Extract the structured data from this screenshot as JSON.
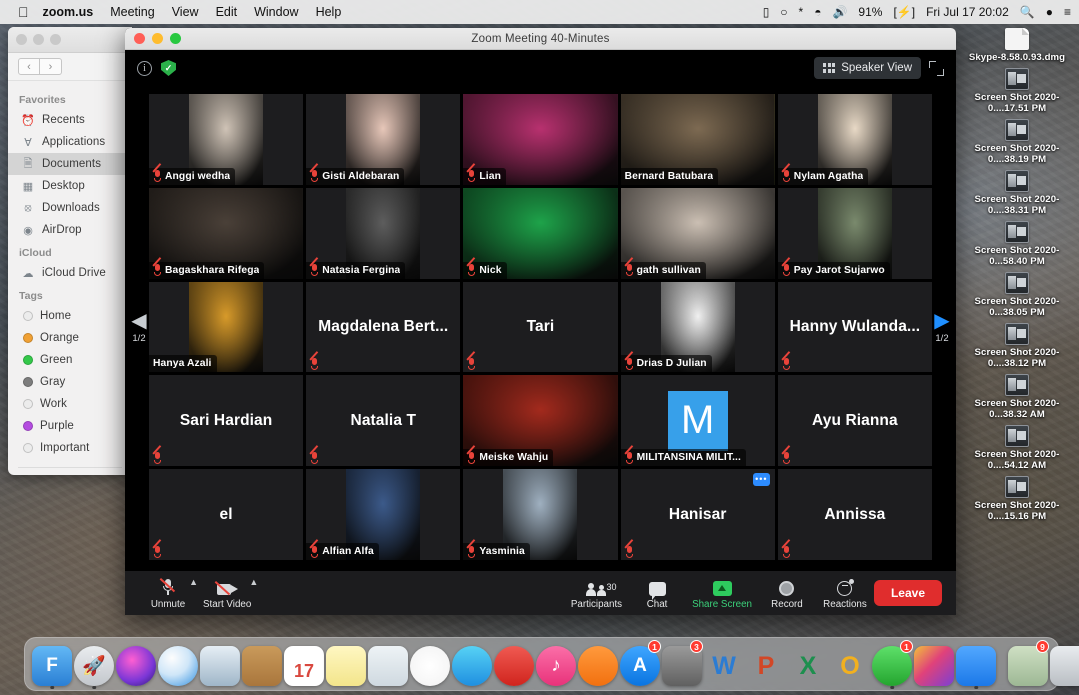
{
  "menubar": {
    "apple": "",
    "items": [
      {
        "label": "zoom.us",
        "bold": true
      },
      {
        "label": "Meeting"
      },
      {
        "label": "View"
      },
      {
        "label": "Edit"
      },
      {
        "label": "Window"
      },
      {
        "label": "Help"
      }
    ],
    "status": {
      "battery_percent": "91%",
      "charging": "[⚡]",
      "datetime": "Fri Jul 17  20:02",
      "search_icon": "search-icon",
      "siri_icon": "siri-icon",
      "controlcenter_icon": "notification-center-icon",
      "display_icon": "display-icon",
      "timemachine_icon": "time-machine-icon",
      "bluetooth_icon": "bluetooth-icon",
      "wifi_icon": "wifi-icon",
      "volume_icon": "volume-icon"
    }
  },
  "finder": {
    "back_label": "‹",
    "forward_label": "›",
    "sections": [
      {
        "title": "Favorites",
        "items": [
          {
            "label": "Recents",
            "icon": "clock-icon",
            "glyph": "◷",
            "selected": false
          },
          {
            "label": "Applications",
            "icon": "applications-icon",
            "glyph": "A",
            "selected": false
          },
          {
            "label": "Documents",
            "icon": "documents-folder-icon",
            "glyph": "🗎",
            "selected": true
          },
          {
            "label": "Desktop",
            "icon": "desktop-icon",
            "glyph": "▤",
            "selected": false
          },
          {
            "label": "Downloads",
            "icon": "downloads-icon",
            "glyph": "⬇",
            "selected": false
          },
          {
            "label": "AirDrop",
            "icon": "airdrop-icon",
            "glyph": "◉",
            "selected": false
          }
        ]
      },
      {
        "title": "iCloud",
        "items": [
          {
            "label": "iCloud Drive",
            "icon": "cloud-icon",
            "glyph": "☁",
            "selected": false
          }
        ]
      },
      {
        "title": "Tags",
        "tags": [
          {
            "label": "Home",
            "color": "#e8e8e8"
          },
          {
            "label": "Orange",
            "color": "#f0a033"
          },
          {
            "label": "Green",
            "color": "#34c84a"
          },
          {
            "label": "Gray",
            "color": "#7d7d7d"
          },
          {
            "label": "Work",
            "color": "#e8e8e8"
          },
          {
            "label": "Purple",
            "color": "#b44ce0"
          },
          {
            "label": "Important",
            "color": "#e8e8e8"
          }
        ]
      }
    ]
  },
  "desktop_files": [
    {
      "name": "Skype-8.58.0.93.dmg",
      "icon": "dmg-file-icon",
      "type": "doc"
    },
    {
      "name": "Screen Shot 2020-0....17.51 PM",
      "icon": "screenshot-file-icon",
      "type": "shot"
    },
    {
      "name": "Screen Shot 2020-0....38.19 PM",
      "icon": "screenshot-file-icon",
      "type": "shot"
    },
    {
      "name": "Screen Shot 2020-0....38.31 PM",
      "icon": "screenshot-file-icon",
      "type": "shot"
    },
    {
      "name": "Screen Shot 2020-0...58.40 PM",
      "icon": "screenshot-file-icon",
      "type": "shot"
    },
    {
      "name": "Screen Shot 2020-0...38.05 PM",
      "icon": "screenshot-file-icon",
      "type": "shot"
    },
    {
      "name": "Screen Shot 2020-0....38.12 PM",
      "icon": "screenshot-file-icon",
      "type": "shot"
    },
    {
      "name": "Screen Shot 2020-0...38.32 AM",
      "icon": "screenshot-file-icon",
      "type": "shot"
    },
    {
      "name": "Screen Shot 2020-0....54.12 AM",
      "icon": "screenshot-file-icon",
      "type": "shot"
    },
    {
      "name": "Screen Shot 2020-0....15.16 PM",
      "icon": "screenshot-file-icon",
      "type": "shot"
    }
  ],
  "zoom_window": {
    "title": "Zoom Meeting   40-Minutes",
    "info_icon": "info-icon",
    "encryption_icon": "shield-encryption-icon",
    "view_button": "Speaker View",
    "view_icon": "grid-view-icon",
    "fullscreen_icon": "fullscreen-icon",
    "pager": {
      "left_icon": "previous-page-arrow",
      "right_icon": "next-page-arrow",
      "left_label": "1/2",
      "right_label": "1/2"
    },
    "participants": [
      {
        "name": "Anggi wedha",
        "muted": true,
        "video": true,
        "active": false,
        "kind": "portrait",
        "tone": "#cfc3b6"
      },
      {
        "name": "Gisti Aldebaran",
        "muted": true,
        "video": true,
        "active": false,
        "kind": "portrait",
        "tone": "#e7c7b9"
      },
      {
        "name": "Lian",
        "muted": true,
        "video": true,
        "active": false,
        "kind": "wide",
        "tone": "#b8316f"
      },
      {
        "name": "Bernard Batubara",
        "muted": false,
        "video": true,
        "active": true,
        "kind": "wide",
        "tone": "#7d6a52"
      },
      {
        "name": "Nylam Agatha",
        "muted": true,
        "video": true,
        "active": false,
        "kind": "portrait",
        "tone": "#e8d9c6"
      },
      {
        "name": "Bagaskhara Rifega",
        "muted": true,
        "video": true,
        "active": false,
        "kind": "wide",
        "tone": "#4a4038"
      },
      {
        "name": "Natasia Fergina",
        "muted": true,
        "video": true,
        "active": false,
        "kind": "portrait",
        "tone": "#5d5d5d"
      },
      {
        "name": "Nick",
        "muted": true,
        "video": true,
        "active": false,
        "kind": "wide",
        "tone": "#1ea34a"
      },
      {
        "name": "gath sullivan",
        "muted": true,
        "video": true,
        "active": false,
        "kind": "wide",
        "tone": "#cbbfb3"
      },
      {
        "name": "Pay Jarot Sujarwo",
        "muted": true,
        "video": true,
        "active": false,
        "kind": "portrait",
        "tone": "#7a8a6d"
      },
      {
        "name": "Hanya Azali",
        "muted": false,
        "video": true,
        "active": false,
        "kind": "portrait",
        "tone": "#d79a2a"
      },
      {
        "name": "Magdalena Bert...",
        "muted": true,
        "video": false,
        "active": false,
        "kind": "none",
        "tone": "#1d1d1f"
      },
      {
        "name": "Tari",
        "muted": true,
        "video": false,
        "active": false,
        "kind": "none",
        "tone": "#1d1d1f"
      },
      {
        "name": "Drias D Julian",
        "muted": true,
        "video": true,
        "active": false,
        "kind": "portrait",
        "tone": "#f0f0f0"
      },
      {
        "name": "Hanny Wulanda...",
        "muted": true,
        "video": false,
        "active": false,
        "kind": "none",
        "tone": "#1d1d1f"
      },
      {
        "name": "Sari Hardian",
        "muted": true,
        "video": false,
        "active": false,
        "kind": "none",
        "tone": "#1d1d1f"
      },
      {
        "name": "Natalia T",
        "muted": true,
        "video": false,
        "active": false,
        "kind": "none",
        "tone": "#1d1d1f"
      },
      {
        "name": "Meiske Wahju",
        "muted": true,
        "video": true,
        "active": false,
        "kind": "wide",
        "tone": "#a32a1d"
      },
      {
        "name": "MILITANSINA MILIT...",
        "muted": true,
        "video": false,
        "active": false,
        "kind": "letter",
        "tone": "#37a0ea",
        "letter": "M"
      },
      {
        "name": "Ayu Rianna",
        "muted": true,
        "video": false,
        "active": false,
        "kind": "none",
        "tone": "#1d1d1f"
      },
      {
        "name": "el",
        "muted": true,
        "video": false,
        "active": false,
        "kind": "none",
        "tone": "#1d1d1f"
      },
      {
        "name": "Alfian Alfa",
        "muted": true,
        "video": true,
        "active": false,
        "kind": "portrait",
        "tone": "#3c5a8a"
      },
      {
        "name": "Yasminia",
        "muted": true,
        "video": true,
        "active": false,
        "kind": "portrait",
        "tone": "#9fb0c0"
      },
      {
        "name": "Hanisar",
        "muted": true,
        "video": false,
        "active": false,
        "kind": "none",
        "tone": "#1d1d1f",
        "more": "•••"
      },
      {
        "name": "Annissa",
        "muted": true,
        "video": false,
        "active": false,
        "kind": "none",
        "tone": "#1d1d1f"
      }
    ],
    "toolbar": {
      "unmute_label": "Unmute",
      "unmute_icon": "microphone-muted-icon",
      "start_video_label": "Start Video",
      "start_video_icon": "camera-off-icon",
      "participants_label": "Participants",
      "participants_icon": "participants-icon",
      "participants_count": "30",
      "chat_label": "Chat",
      "chat_icon": "chat-bubble-icon",
      "share_label": "Share Screen",
      "share_icon": "share-screen-icon",
      "record_label": "Record",
      "record_icon": "record-icon",
      "reactions_label": "Reactions",
      "reactions_icon": "reactions-icon",
      "leave_label": "Leave"
    }
  },
  "dock": {
    "apps": [
      {
        "name": "finder",
        "label": "F",
        "bg": "linear-gradient(#63b8f5,#2a7fd4)",
        "round": false,
        "running": true
      },
      {
        "name": "launchpad",
        "label": "🚀",
        "bg": "linear-gradient(#e9ecef,#c3c7cc)",
        "round": true,
        "running": true
      },
      {
        "name": "siri",
        "label": "",
        "bg": "radial-gradient(circle at 40% 35%,#ff5fd2,#7a36d6 60%,#2a1a6e)",
        "round": true,
        "running": false
      },
      {
        "name": "safari",
        "label": "",
        "bg": "radial-gradient(circle at 35% 30%,#fdfdfd,#cfe6f8 45%,#2f8fe0)",
        "round": true,
        "running": false
      },
      {
        "name": "photos-preview",
        "label": "",
        "bg": "linear-gradient(#e6eef5,#9fb6c8)",
        "round": false,
        "running": false
      },
      {
        "name": "contacts",
        "label": "",
        "bg": "linear-gradient(#c99a5b,#a9763c)",
        "round": false,
        "running": false
      },
      {
        "name": "calendar",
        "label": "17",
        "bg": "#ffffff",
        "round": false,
        "running": false
      },
      {
        "name": "notes",
        "label": "",
        "bg": "linear-gradient(#fff7c2,#f3e58b)",
        "round": false,
        "running": false
      },
      {
        "name": "maps",
        "label": "",
        "bg": "linear-gradient(#eef3f6,#cfd9e0)",
        "round": false,
        "running": false
      },
      {
        "name": "photos",
        "label": "",
        "bg": "radial-gradient(circle at 50% 50%,#fff,#f2f2f2)",
        "round": true,
        "running": false
      },
      {
        "name": "messages",
        "label": "",
        "bg": "linear-gradient(#57d2f5,#1f8fe0)",
        "round": true,
        "running": false
      },
      {
        "name": "mail-no",
        "label": "",
        "bg": "linear-gradient(#f05a52,#d0241d)",
        "round": true,
        "running": false
      },
      {
        "name": "itunes",
        "label": "♪",
        "bg": "linear-gradient(#fb6fa8,#e8327a)",
        "round": true,
        "running": false
      },
      {
        "name": "books",
        "label": "",
        "bg": "linear-gradient(#ff9a3d,#f2700f)",
        "round": true,
        "running": false
      },
      {
        "name": "app-store",
        "label": "A",
        "bg": "linear-gradient(#3fa6ff,#0a74e0)",
        "round": true,
        "running": false,
        "badge": "1"
      },
      {
        "name": "system-preferences",
        "label": "",
        "bg": "linear-gradient(#9a9a9a,#606060)",
        "round": false,
        "running": false,
        "badge": "3"
      },
      {
        "name": "word",
        "label": "W",
        "bg": "transparent",
        "round": false,
        "running": false,
        "color": "#2b7cd3"
      },
      {
        "name": "powerpoint",
        "label": "P",
        "bg": "transparent",
        "round": false,
        "running": false,
        "color": "#d24726"
      },
      {
        "name": "excel",
        "label": "X",
        "bg": "transparent",
        "round": false,
        "running": false,
        "color": "#1d8f4e"
      },
      {
        "name": "outlook",
        "label": "O",
        "bg": "transparent",
        "round": false,
        "running": false,
        "color": "#f2b01e"
      },
      {
        "name": "whatsapp",
        "label": "",
        "bg": "linear-gradient(#5ee06a,#24a52f)",
        "round": true,
        "running": true,
        "badge": "1"
      },
      {
        "name": "final-cut-pro",
        "label": "",
        "bg": "linear-gradient(135deg,#f2c03a,#e0427a 45%,#7b3fd4)",
        "round": false,
        "running": false
      },
      {
        "name": "zoom",
        "label": "",
        "bg": "linear-gradient(#52a8ff,#1b78e8)",
        "round": false,
        "running": true
      },
      {
        "name": "downloads-stack",
        "label": "",
        "bg": "linear-gradient(#cfe0c4,#9db894)",
        "round": false,
        "running": false,
        "badge": "9"
      },
      {
        "name": "trash",
        "label": "",
        "bg": "linear-gradient(#e9ecef,#b9bec3)",
        "round": false,
        "running": false
      }
    ]
  }
}
